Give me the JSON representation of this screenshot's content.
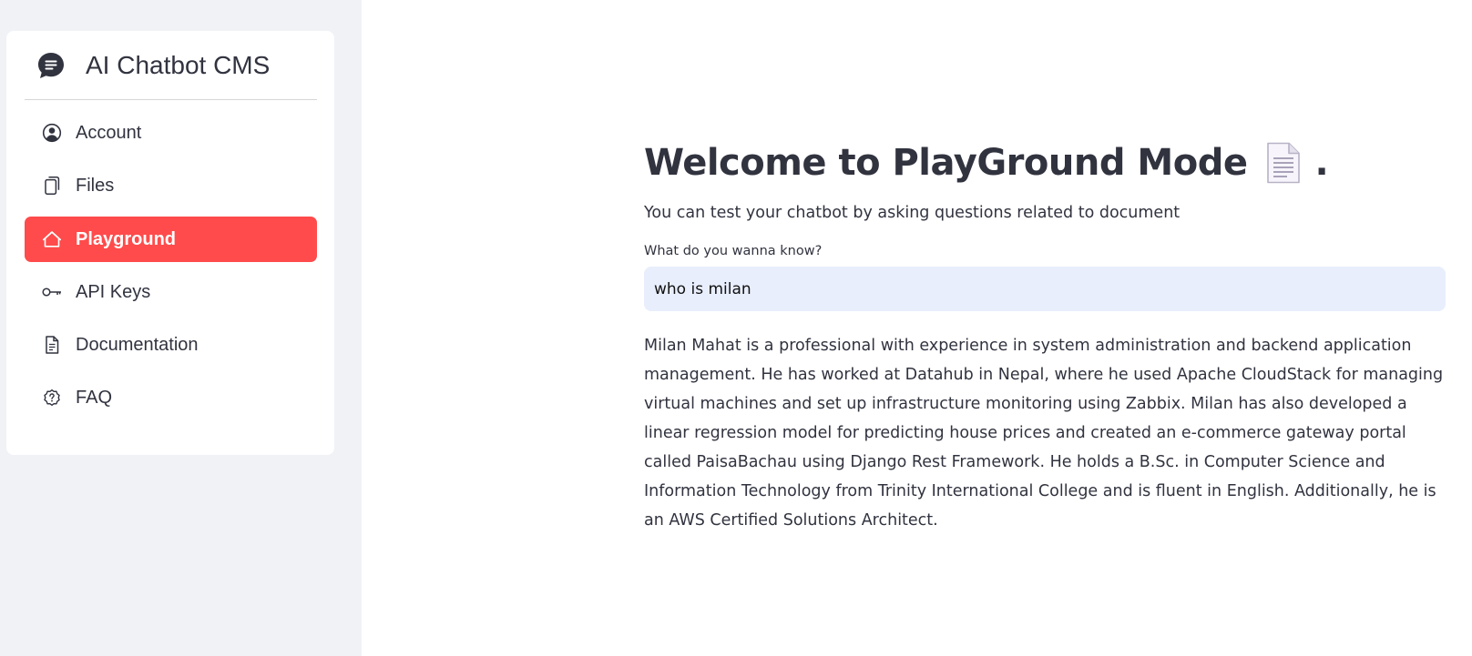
{
  "sidebar": {
    "brand": {
      "title": "AI Chatbot CMS",
      "icon": "chat-bubble-icon"
    },
    "items": [
      {
        "label": "Account",
        "icon": "user-circle-icon",
        "active": false
      },
      {
        "label": "Files",
        "icon": "files-icon",
        "active": false
      },
      {
        "label": "Playground",
        "icon": "house-icon",
        "active": true
      },
      {
        "label": "API Keys",
        "icon": "key-icon",
        "active": false
      },
      {
        "label": "Documentation",
        "icon": "document-icon",
        "active": false
      },
      {
        "label": "FAQ",
        "icon": "question-circle-icon",
        "active": false
      }
    ]
  },
  "main": {
    "title": "Welcome to PlayGround Mode",
    "title_suffix": ".",
    "title_emoji": "page-document-emoji",
    "subtitle": "You can test your chatbot by asking questions related to document",
    "input": {
      "label": "What do you wanna know?",
      "value": "who is milan"
    },
    "answer": "Milan Mahat is a professional with experience in system administration and backend application management. He has worked at Datahub in Nepal, where he used Apache CloudStack for managing virtual machines and set up infrastructure monitoring using Zabbix. Milan has also developed a linear regression model for predicting house prices and created an e-commerce gateway portal called PaisaBachau using Django Rest Framework. He holds a B.Sc. in Computer Science and Information Technology from Trinity International College and is fluent in English. Additionally, he is an AWS Certified Solutions Architect."
  },
  "colors": {
    "accent": "#ff4b4b",
    "sidebar_bg": "#f0f2f6",
    "input_bg": "#e8eefc",
    "text": "#31333f"
  }
}
